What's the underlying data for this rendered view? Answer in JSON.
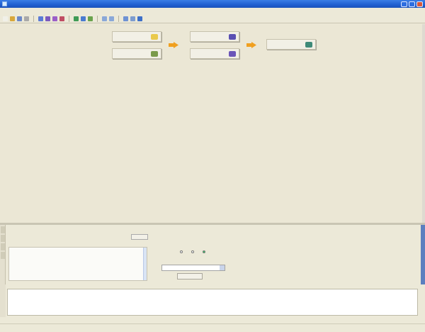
{
  "window": {
    "title": "",
    "controls": [
      "minimize",
      "maximize",
      "close"
    ]
  },
  "menu": {
    "items": [
      "",
      "",
      "",
      "",
      "",
      "",
      "",
      ""
    ]
  },
  "toolbar": {
    "buttons": [
      {
        "icon": "new-icon",
        "color": "#f0f0e8"
      },
      {
        "icon": "open-folder-icon",
        "color": "#d9a83b"
      },
      {
        "icon": "save-icon",
        "color": "#6b88c9"
      },
      {
        "icon": "arrow-icon",
        "color": "#a9a9a9"
      },
      {
        "icon": "run-icon",
        "color": "#5b7bd5"
      },
      {
        "icon": "stop-icon",
        "color": "#7c5bbf"
      },
      {
        "icon": "debug-icon",
        "color": "#9b5fc8"
      },
      {
        "icon": "delete-icon",
        "color": "#c04d63"
      },
      {
        "icon": "green-flag-icon",
        "color": "#3f9b56"
      },
      {
        "icon": "blue-grid-icon",
        "color": "#4a7bd0"
      },
      {
        "icon": "check-icon",
        "color": "#6aa34d"
      },
      {
        "icon": "zoom-in-icon",
        "color": "#8aa8d8"
      },
      {
        "icon": "zoom-out-icon",
        "color": "#8aa8d8"
      },
      {
        "icon": "layout-icon",
        "color": "#6e92d3"
      },
      {
        "icon": "window-icon",
        "color": "#7d9ccf"
      },
      {
        "icon": "help-icon",
        "color": "#3d6fc8"
      }
    ]
  },
  "workflow": {
    "nodes": [
      {
        "label": "",
        "icon_color": "#e9c94b"
      },
      {
        "label": "",
        "icon_color": "#7a9a4a"
      },
      {
        "label": "",
        "icon_color": "#5a4fb3"
      },
      {
        "label": "",
        "icon_color": "#6b55b8"
      },
      {
        "label": "",
        "icon_color": "#3f8a78"
      }
    ],
    "arrow_color": "#f0a020"
  },
  "properties": {
    "rows": [
      "",
      ""
    ],
    "browse_label": "",
    "table": [
      {
        "key": "",
        "value": ""
      },
      {
        "key": "",
        "value": ""
      },
      {
        "key": "",
        "value": ""
      },
      {
        "key": "",
        "value": ""
      },
      {
        "key": "",
        "value": ""
      },
      {
        "key": "",
        "value": ""
      },
      {
        "key": "",
        "value": ""
      },
      {
        "key": "",
        "value": ""
      },
      {
        "key": "",
        "value": ""
      }
    ]
  },
  "options": {
    "radios": [
      {
        "label": "",
        "selected": false
      },
      {
        "label": "",
        "selected": false
      },
      {
        "label": "",
        "selected": true
      }
    ],
    "field_label": "",
    "combo_value": "",
    "button_label": ""
  },
  "console": {
    "tab_label": "",
    "lines": [
      "",
      "",
      "",
      ""
    ]
  },
  "status": {
    "left": "",
    "right": ""
  }
}
